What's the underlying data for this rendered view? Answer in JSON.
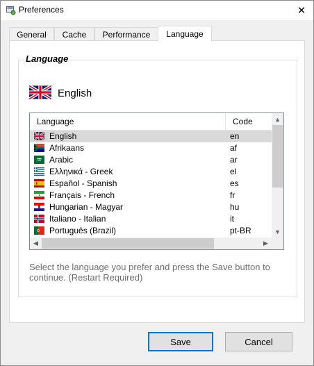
{
  "window": {
    "title": "Preferences"
  },
  "tabs": [
    {
      "label": "General"
    },
    {
      "label": "Cache"
    },
    {
      "label": "Performance"
    },
    {
      "label": "Language"
    }
  ],
  "active_tab": "Language",
  "language_group": {
    "title": "Language",
    "current_language": "English",
    "current_flag": "uk-flag-icon"
  },
  "language_list": {
    "columns": [
      "Language",
      "Code"
    ],
    "selected_index": 0,
    "rows": [
      {
        "name": "English",
        "code": "en",
        "flag": "uk-flag-icon"
      },
      {
        "name": "Afrikaans",
        "code": "af",
        "flag": "south-africa-flag-icon"
      },
      {
        "name": "Arabic",
        "code": "ar",
        "flag": "saudi-arabia-flag-icon"
      },
      {
        "name": "Ελληνικά - Greek",
        "code": "el",
        "flag": "greece-flag-icon"
      },
      {
        "name": "Español - Spanish",
        "code": "es",
        "flag": "spain-flag-icon"
      },
      {
        "name": "Français - French",
        "code": "fr",
        "flag": "iran-flag-icon"
      },
      {
        "name": "Hungarian - Magyar",
        "code": "hu",
        "flag": "croatia-flag-icon"
      },
      {
        "name": "Italiano - Italian",
        "code": "it",
        "flag": "norway-flag-icon"
      },
      {
        "name": "Português (Brazil)",
        "code": "pt-BR",
        "flag": "portugal-flag-icon"
      }
    ]
  },
  "hint": "Select the language you prefer and press the Save button to continue. (Restart Required)",
  "buttons": {
    "save": "Save",
    "cancel": "Cancel"
  }
}
